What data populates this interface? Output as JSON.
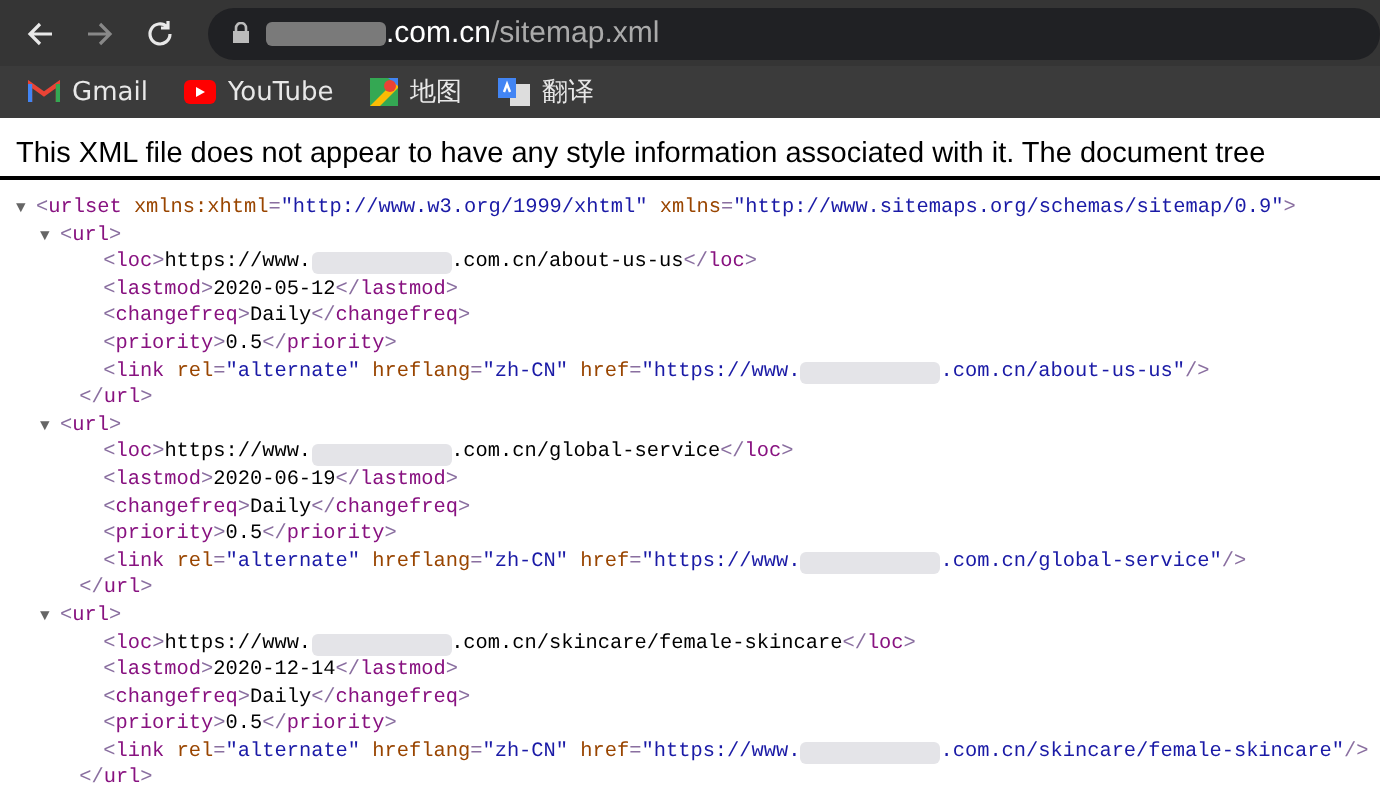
{
  "toolbar": {
    "buttons": [
      {
        "kind": "back",
        "disabled": false
      },
      {
        "kind": "forward",
        "disabled": true
      },
      {
        "kind": "reload",
        "disabled": false
      }
    ],
    "address": {
      "redacted": true,
      "host_suffix": ".com.cn",
      "path": "/sitemap.xml"
    }
  },
  "bookmarks": [
    {
      "kind": "gmail",
      "label": "Gmail"
    },
    {
      "kind": "youtube",
      "label": "YouTube"
    },
    {
      "kind": "maps",
      "label": "地图"
    },
    {
      "kind": "translate",
      "label": "翻译"
    }
  ],
  "notice": "This XML file does not appear to have any style information associated with it. The document tree",
  "syntax": {
    "toggle": "▼",
    "lt": "<",
    "gt": ">",
    "end": "</",
    "self_end": "/>",
    "eq": "=",
    "quote": "\""
  },
  "xml": {
    "tag": "urlset",
    "expanded": true,
    "attrs": [
      {
        "name": "xmlns:xhtml",
        "value": "http://www.w3.org/1999/xhtml"
      },
      {
        "name": "xmlns",
        "value": "http://www.sitemaps.org/schemas/sitemap/0.9"
      }
    ],
    "children": [
      {
        "tag": "url",
        "close_tag": "url",
        "expanded": true,
        "children": [
          {
            "tag": "loc",
            "close_tag": "loc",
            "text": "https://www.",
            "redacted": true,
            "text_after": ".com.cn/about-us-us"
          },
          {
            "tag": "lastmod",
            "close_tag": "lastmod",
            "text": "2020-05-12"
          },
          {
            "tag": "changefreq",
            "close_tag": "changefreq",
            "text": "Daily"
          },
          {
            "tag": "priority",
            "close_tag": "priority",
            "text": "0.5"
          },
          {
            "tag": "link",
            "self_closing": true,
            "attrs": [
              {
                "name": "rel",
                "value": "alternate"
              },
              {
                "name": "hreflang",
                "value": "zh-CN"
              },
              {
                "name": "href",
                "value": "https://www.",
                "redacted": true,
                "value_after": ".com.cn/about-us-us"
              }
            ]
          }
        ]
      },
      {
        "tag": "url",
        "close_tag": "url",
        "expanded": true,
        "children": [
          {
            "tag": "loc",
            "close_tag": "loc",
            "text": "https://www.",
            "redacted": true,
            "text_after": ".com.cn/global-service"
          },
          {
            "tag": "lastmod",
            "close_tag": "lastmod",
            "text": "2020-06-19"
          },
          {
            "tag": "changefreq",
            "close_tag": "changefreq",
            "text": "Daily"
          },
          {
            "tag": "priority",
            "close_tag": "priority",
            "text": "0.5"
          },
          {
            "tag": "link",
            "self_closing": true,
            "attrs": [
              {
                "name": "rel",
                "value": "alternate"
              },
              {
                "name": "hreflang",
                "value": "zh-CN"
              },
              {
                "name": "href",
                "value": "https://www.",
                "redacted": true,
                "value_after": ".com.cn/global-service"
              }
            ]
          }
        ]
      },
      {
        "tag": "url",
        "close_tag": "url",
        "expanded": true,
        "children": [
          {
            "tag": "loc",
            "close_tag": "loc",
            "text": "https://www.",
            "redacted": true,
            "text_after": ".com.cn/skincare/female-skincare"
          },
          {
            "tag": "lastmod",
            "close_tag": "lastmod",
            "text": "2020-12-14"
          },
          {
            "tag": "changefreq",
            "close_tag": "changefreq",
            "text": "Daily"
          },
          {
            "tag": "priority",
            "close_tag": "priority",
            "text": "0.5"
          },
          {
            "tag": "link",
            "self_closing": true,
            "attrs": [
              {
                "name": "rel",
                "value": "alternate"
              },
              {
                "name": "hreflang",
                "value": "zh-CN"
              },
              {
                "name": "href",
                "value": "https://www.",
                "redacted": true,
                "value_after": ".com.cn/skincare/female-skincare"
              }
            ]
          }
        ]
      }
    ]
  }
}
